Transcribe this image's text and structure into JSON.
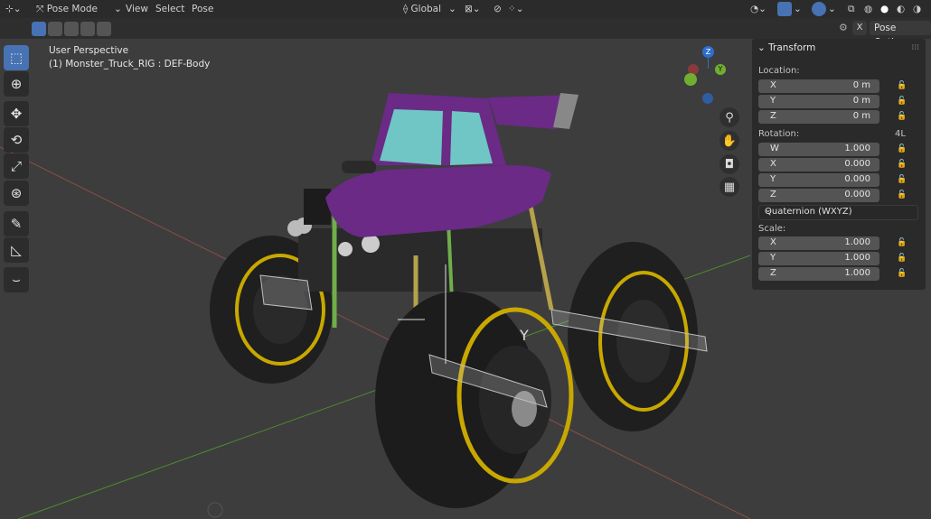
{
  "header": {
    "mode": "Pose Mode",
    "menu": [
      "View",
      "Select",
      "Pose"
    ],
    "orientation": "Global",
    "pose_options": "Pose Options"
  },
  "viewport": {
    "perspective": "User Perspective",
    "object": "(1) Monster_Truck_RIG : DEF-Body"
  },
  "gizmo": {
    "z": "Z",
    "y": "Y"
  },
  "transform": {
    "title": "Transform",
    "location_label": "Location:",
    "location": [
      {
        "axis": "X",
        "value": "0 m"
      },
      {
        "axis": "Y",
        "value": "0 m"
      },
      {
        "axis": "Z",
        "value": "0 m"
      }
    ],
    "rotation_label": "Rotation:",
    "rotation_mode_short": "4L",
    "rotation": [
      {
        "axis": "W",
        "value": "1.000"
      },
      {
        "axis": "X",
        "value": "0.000"
      },
      {
        "axis": "Y",
        "value": "0.000"
      },
      {
        "axis": "Z",
        "value": "0.000"
      }
    ],
    "rotation_mode": "Quaternion (WXYZ)",
    "scale_label": "Scale:",
    "scale": [
      {
        "axis": "X",
        "value": "1.000"
      },
      {
        "axis": "Y",
        "value": "1.000"
      },
      {
        "axis": "Z",
        "value": "1.000"
      }
    ]
  },
  "colors": {
    "active_tool": "#4772b3",
    "truck_body": "#6a2a86",
    "windows": "#6fc6c4",
    "rims": "#c8a800",
    "x_axis": "#b54a3a",
    "y_axis": "#5a9a2a"
  },
  "tools": [
    "select-box-icon",
    "cursor-icon",
    "move-icon",
    "rotate-icon",
    "scale-icon",
    "transform-icon",
    "annotate-icon",
    "measure-icon",
    "relax-icon"
  ]
}
